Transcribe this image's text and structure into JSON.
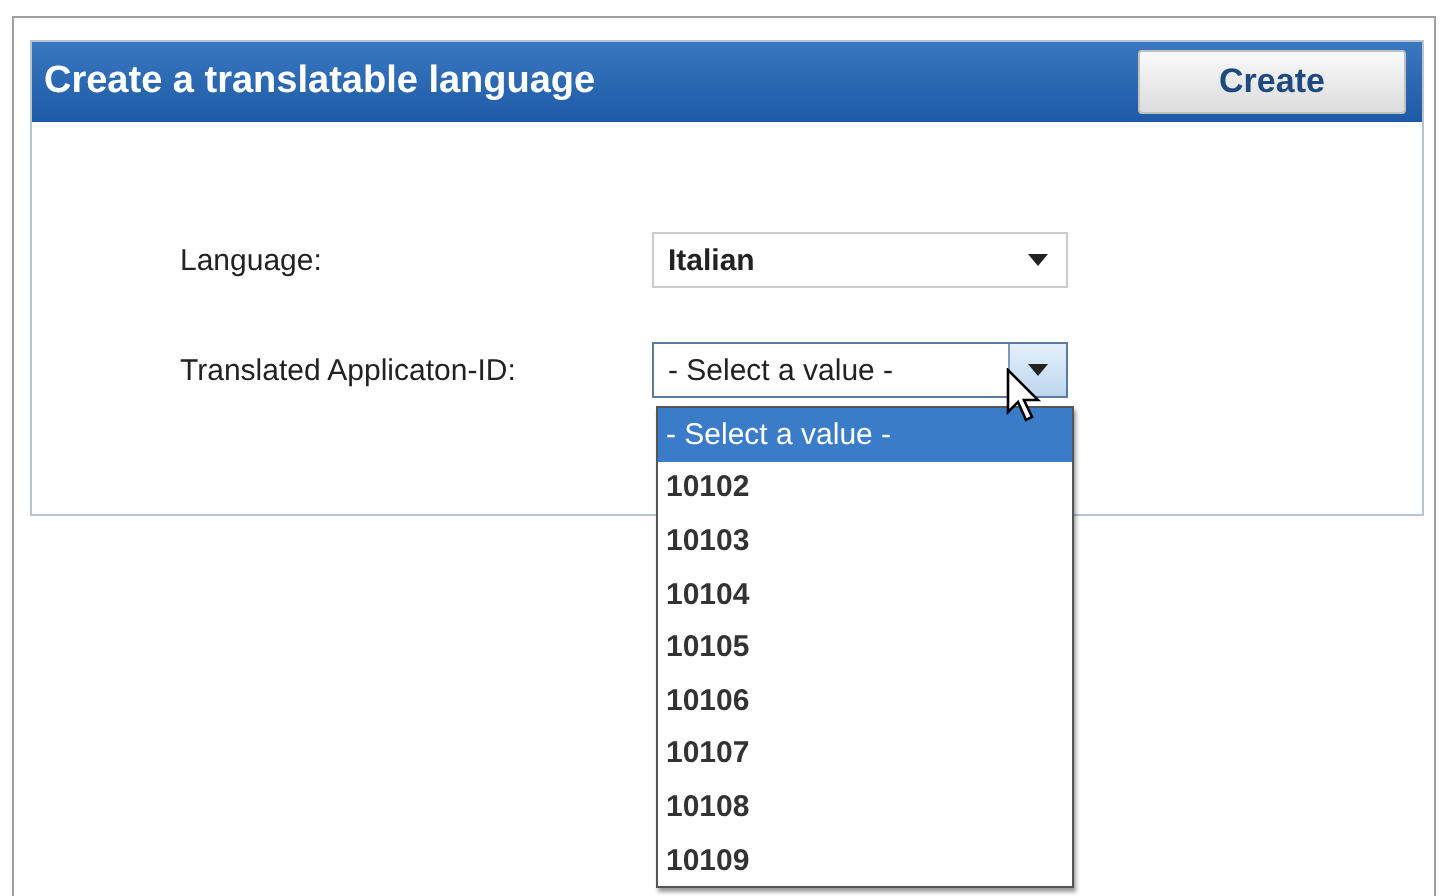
{
  "panel": {
    "title": "Create a translatable language",
    "button": "Create"
  },
  "fields": [
    {
      "label": "Language:",
      "value": "Italian",
      "expanded": false
    },
    {
      "label": "Translated Applicaton-ID:",
      "value": "- Select a value -",
      "expanded": true
    }
  ],
  "dropdown": {
    "options": [
      {
        "label": "- Select a value -",
        "selected": true
      },
      {
        "label": "10102",
        "selected": false
      },
      {
        "label": "10103",
        "selected": false
      },
      {
        "label": "10104",
        "selected": false
      },
      {
        "label": "10105",
        "selected": false
      },
      {
        "label": "10106",
        "selected": false
      },
      {
        "label": "10107",
        "selected": false
      },
      {
        "label": "10108",
        "selected": false
      },
      {
        "label": "10109",
        "selected": false
      }
    ]
  }
}
